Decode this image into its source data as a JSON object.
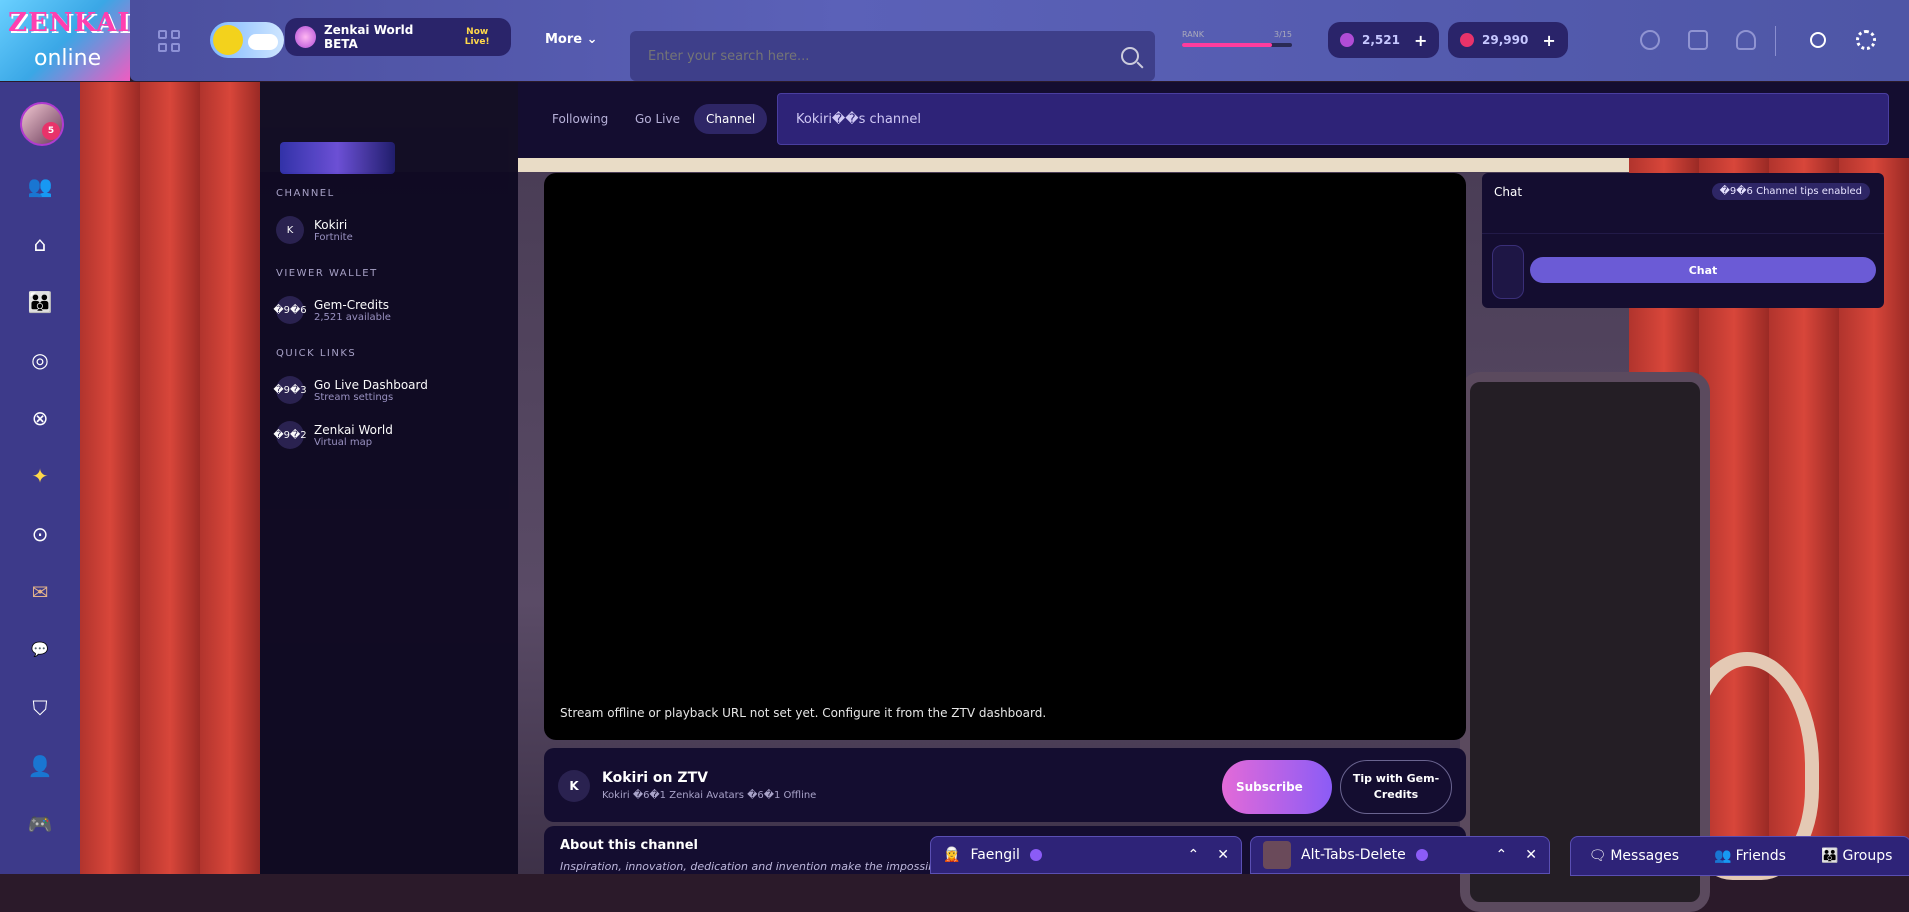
{
  "logo": {
    "title": "ZENKAI",
    "sub": "online"
  },
  "topbar": {
    "zenkai_world": "Zenkai World BETA",
    "now_live": "Now Live!",
    "more": "More",
    "search_placeholder": "Enter your search here...",
    "rank_left": "RANK",
    "rank_right": "3/15",
    "rank_progress": 0.82,
    "currency_gems": "2,521",
    "currency_orbs": "29,990"
  },
  "rail": {
    "avatar_badge": "5"
  },
  "sidebar": {
    "channel_heading": "CHANNEL",
    "channel_initial": "K",
    "channel_name": "Kokiri",
    "channel_game": "Fortnite",
    "wallet_heading": "VIEWER WALLET",
    "wallet_icon": "�9�6",
    "wallet_title": "Gem-Credits",
    "wallet_available": "2,521 available",
    "links_heading": "QUICK LINKS",
    "link1_icon": "�9�3",
    "link1_title": "Go Live Dashboard",
    "link1_sub": "Stream settings",
    "link2_icon": "�9�2",
    "link2_title": "Zenkai World",
    "link2_sub": "Virtual map"
  },
  "tabs": {
    "following": "Following",
    "golive": "Go Live",
    "channel": "Channel"
  },
  "channel_title": "Kokiri��s channel",
  "player": {
    "message": "Stream offline or playback URL not set yet. Configure it from the ZTV dashboard."
  },
  "info": {
    "initial": "K",
    "name": "Kokiri on ZTV",
    "meta": "Kokiri �6�1 Zenkai Avatars �6�1 Offline",
    "subscribe": "Subscribe",
    "tip": "Tip with Gem-Credits"
  },
  "about": {
    "heading": "About this channel",
    "text": "Inspiration, innovation, dedication and invention make the impossible,"
  },
  "chat": {
    "heading": "Chat",
    "tips": "�9�6 Channel tips enabled",
    "button": "Chat"
  },
  "dock": {
    "chat1": "Faengil",
    "chat2": "Alt-Tabs-Delete",
    "messages": "Messages",
    "friends": "Friends",
    "groups": "Groups"
  }
}
